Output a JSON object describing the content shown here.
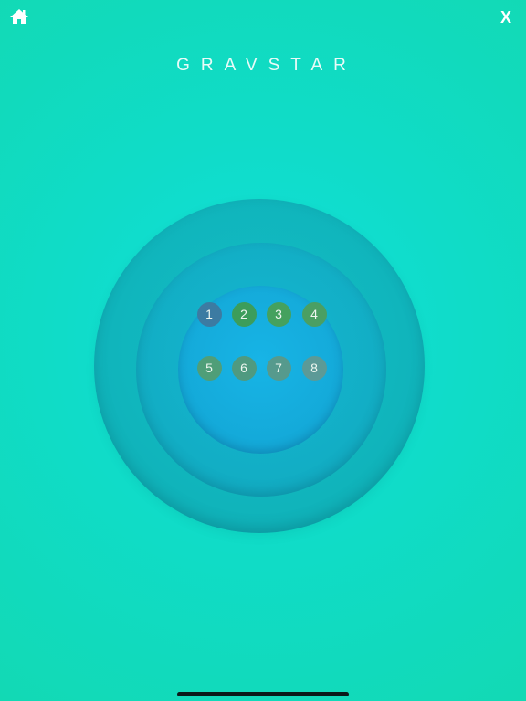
{
  "header": {
    "home_icon": "home-icon",
    "close_label": "X",
    "title": "GRAVSTAR"
  },
  "levels": [
    {
      "label": "1",
      "color": "#3c7ba2"
    },
    {
      "label": "2",
      "color": "#3c9d5b"
    },
    {
      "label": "3",
      "color": "#45a15e"
    },
    {
      "label": "4",
      "color": "#4a9f63"
    },
    {
      "label": "5",
      "color": "#4f9e78"
    },
    {
      "label": "6",
      "color": "#4f9a80"
    },
    {
      "label": "7",
      "color": "#569a8d"
    },
    {
      "label": "8",
      "color": "#5c9a97"
    }
  ],
  "colors": {
    "background": "#10dcc8",
    "ring_outer": "#10b3ba",
    "ring_middle": "#12acc2",
    "ring_inner": "#14a9d8"
  }
}
